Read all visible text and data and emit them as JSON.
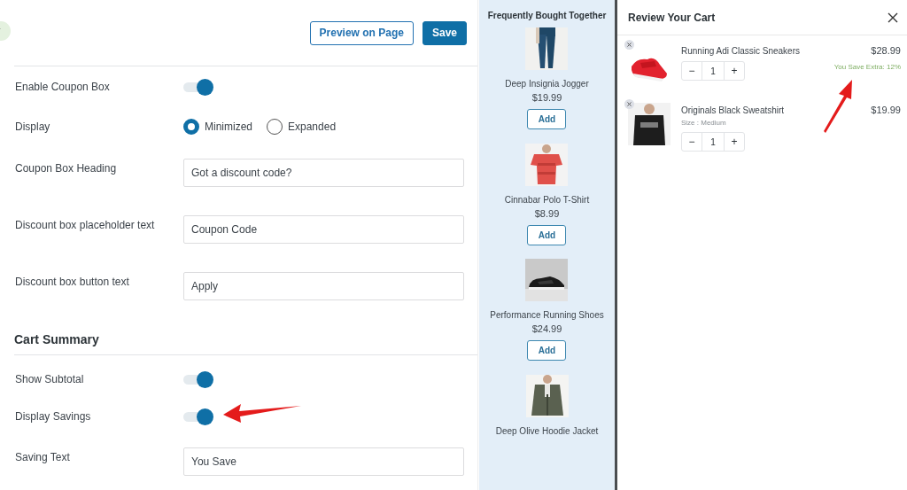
{
  "header": {
    "buttons": [
      {
        "label": "Preview on Page",
        "kind": "outline"
      },
      {
        "label": "Save",
        "kind": "primary"
      }
    ]
  },
  "coupon_settings": [
    {
      "kind": "toggle",
      "label": "Enable Coupon Box",
      "on": true
    },
    {
      "kind": "radio",
      "label": "Display",
      "options": [
        {
          "label": "Minimized",
          "selected": true
        },
        {
          "label": "Expanded",
          "selected": false
        }
      ]
    },
    {
      "kind": "text",
      "label": "Coupon Box Heading",
      "value": "Got a discount code?"
    },
    {
      "kind": "text",
      "label": "Discount box placeholder text",
      "value": "Coupon Code"
    },
    {
      "kind": "text",
      "label": "Discount box button text",
      "value": "Apply"
    }
  ],
  "cart_summary": {
    "heading": "Cart Summary",
    "settings": [
      {
        "kind": "toggle",
        "label": "Show Subtotal",
        "on": true
      },
      {
        "kind": "toggle",
        "label": "Display Savings",
        "on": true
      },
      {
        "kind": "text",
        "label": "Saving Text",
        "value": "You Save"
      }
    ]
  },
  "frequently_bought_together": {
    "title": "Frequently Bought Together",
    "products": [
      {
        "kind": "picture",
        "name": "Deep Insignia Jogger",
        "price": "$19.99",
        "button": "Add"
      },
      {
        "kind": "picture",
        "name": "Cinnabar Polo T-Shirt",
        "price": "$8.99",
        "button": "Add"
      },
      {
        "kind": "picture",
        "name": "Performance Running Shoes",
        "price": "$24.99",
        "button": "Add"
      },
      {
        "kind": "picture",
        "name": "Deep Olive Hoodie Jacket"
      }
    ]
  },
  "cart": {
    "title": "Review Your Cart",
    "items": [
      {
        "kind": "picture",
        "name": "Running Adi Classic Sneakers",
        "price": "$28.99",
        "saving": "You Save Extra: 12%",
        "decrement": "−",
        "quantity": "1",
        "increment": "+"
      },
      {
        "kind": "picture",
        "name": "Originals Black Sweatshirt",
        "size": "Size : Medium",
        "price": "$19.99",
        "decrement": "−",
        "quantity": "1",
        "increment": "+"
      }
    ]
  }
}
